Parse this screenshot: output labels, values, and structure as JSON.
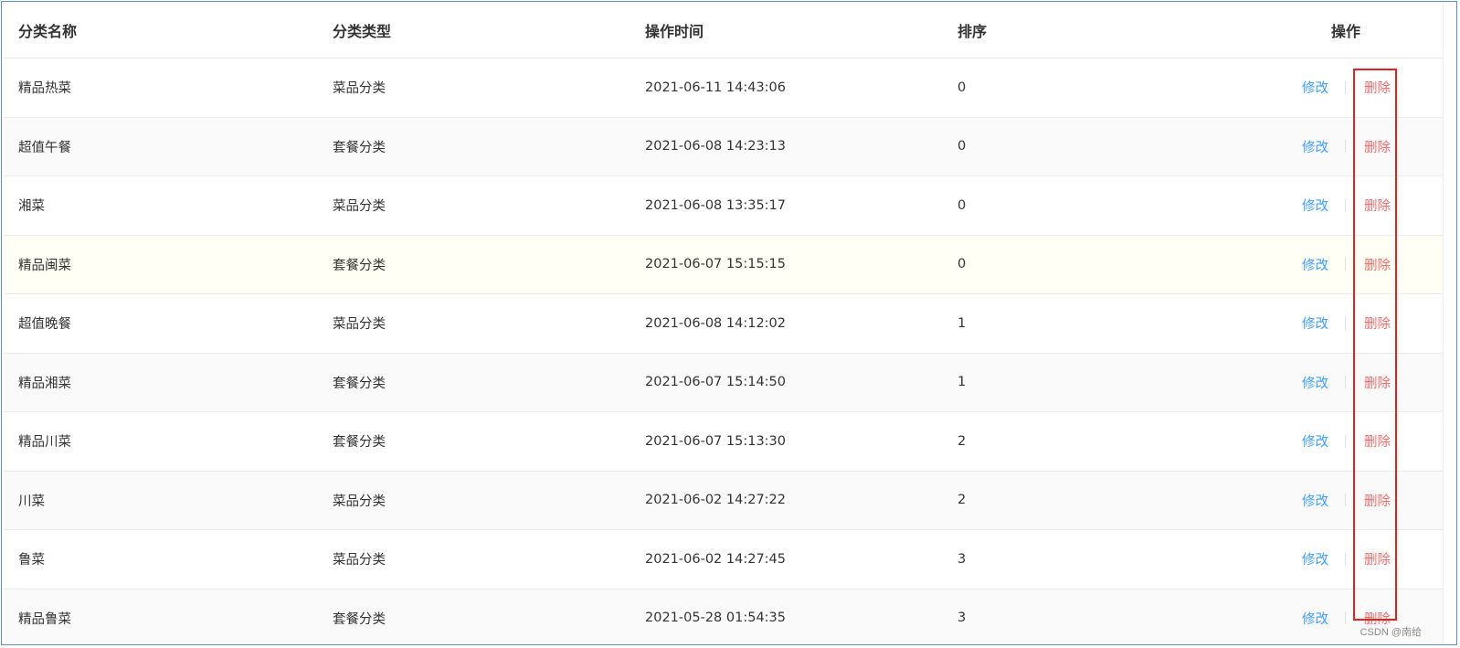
{
  "table": {
    "headers": {
      "name": "分类名称",
      "type": "分类类型",
      "time": "操作时间",
      "sort": "排序",
      "ops": "操作"
    },
    "rows": [
      {
        "name": "精品热菜",
        "type": "菜品分类",
        "time": "2021-06-11 14:43:06",
        "sort": "0"
      },
      {
        "name": "超值午餐",
        "type": "套餐分类",
        "time": "2021-06-08 14:23:13",
        "sort": "0"
      },
      {
        "name": "湘菜",
        "type": "菜品分类",
        "time": "2021-06-08 13:35:17",
        "sort": "0"
      },
      {
        "name": "精品闽菜",
        "type": "套餐分类",
        "time": "2021-06-07 15:15:15",
        "sort": "0"
      },
      {
        "name": "超值晚餐",
        "type": "菜品分类",
        "time": "2021-06-08 14:12:02",
        "sort": "1"
      },
      {
        "name": "精品湘菜",
        "type": "套餐分类",
        "time": "2021-06-07 15:14:50",
        "sort": "1"
      },
      {
        "name": "精品川菜",
        "type": "套餐分类",
        "time": "2021-06-07 15:13:30",
        "sort": "2"
      },
      {
        "name": "川菜",
        "type": "菜品分类",
        "time": "2021-06-02 14:27:22",
        "sort": "2"
      },
      {
        "name": "鲁菜",
        "type": "菜品分类",
        "time": "2021-06-02 14:27:45",
        "sort": "3"
      },
      {
        "name": "精品鲁菜",
        "type": "套餐分类",
        "time": "2021-05-28 01:54:35",
        "sort": "3"
      }
    ],
    "actions": {
      "edit_label": "修改",
      "delete_label": "删除"
    }
  },
  "colors": {
    "edit_link": "#409eff",
    "delete_link": "#f56c6c",
    "annotation_box": "#e52222",
    "frame_border": "#5b8ed6"
  },
  "watermark": "CSDN @南给"
}
